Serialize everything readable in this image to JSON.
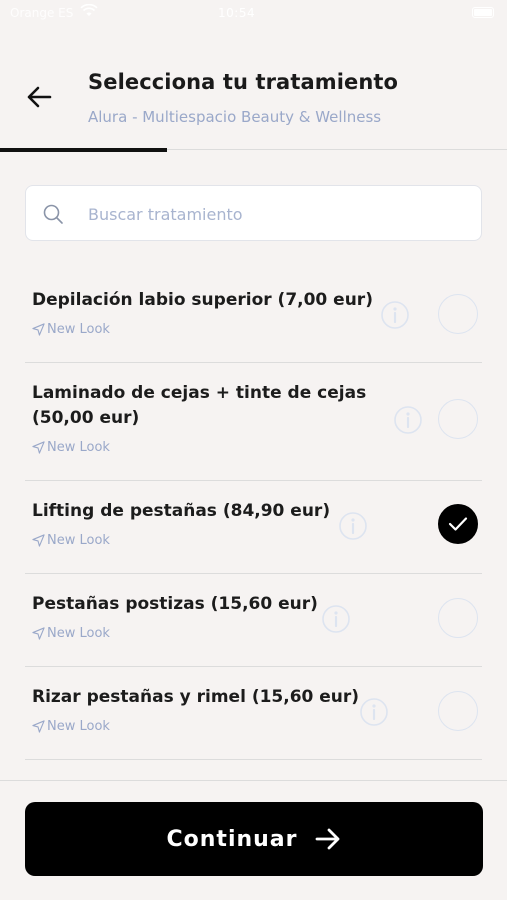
{
  "status_bar": {
    "carrier": "Orange ES",
    "time": "10:54"
  },
  "header": {
    "title": "Selecciona tu tratamiento",
    "subtitle": "Alura - Multiespacio Beauty & Wellness"
  },
  "progress": {
    "fraction": 0.33
  },
  "search": {
    "placeholder": "Buscar tratamiento",
    "value": ""
  },
  "treatments": [
    {
      "name": "Depilación labio superior (7,00 eur)",
      "location": "New Look",
      "selected": false
    },
    {
      "name": "Laminado de cejas + tinte de cejas (50,00 eur)",
      "location": "New Look",
      "selected": false
    },
    {
      "name": "Lifting de pestañas (84,90 eur)",
      "location": "New Look",
      "selected": true
    },
    {
      "name": "Pestañas postizas (15,60 eur)",
      "location": "New Look",
      "selected": false
    },
    {
      "name": "Rizar pestañas y rimel (15,60 eur)",
      "location": "New Look",
      "selected": false
    }
  ],
  "footer": {
    "continue_label": "Continuar"
  },
  "colors": {
    "background": "#f6f3f2",
    "accent": "#000000",
    "muted_text": "#9aa8c9",
    "radio_border": "#dde4f0"
  },
  "icons": {
    "back": "arrow-left-icon",
    "search": "search-icon",
    "info": "info-icon",
    "location": "navigation-arrow-icon",
    "check": "check-icon",
    "continue": "arrow-right-icon"
  }
}
